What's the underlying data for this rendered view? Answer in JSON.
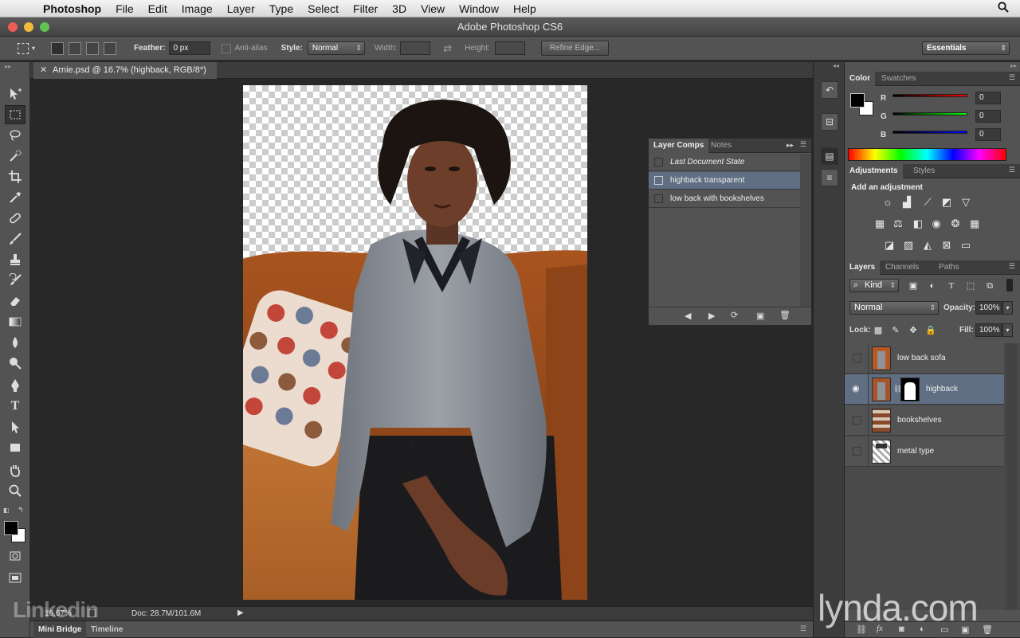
{
  "menubar": {
    "app": "Photoshop",
    "items": [
      "File",
      "Edit",
      "Image",
      "Layer",
      "Type",
      "Select",
      "Filter",
      "3D",
      "View",
      "Window",
      "Help"
    ]
  },
  "window": {
    "title": "Adobe Photoshop CS6"
  },
  "options": {
    "feather_label": "Feather:",
    "feather_value": "0 px",
    "antialias_label": "Anti-alias",
    "style_label": "Style:",
    "style_value": "Normal",
    "width_label": "Width:",
    "height_label": "Height:",
    "refine_button": "Refine Edge...",
    "workspace": "Essentials"
  },
  "document": {
    "tab_title": "Arnie.psd @ 16.7% (highback, RGB/8*)"
  },
  "status": {
    "zoom": "16.67%",
    "doc": "Doc: 28.7M/101.6M"
  },
  "bottom_tabs": [
    "Mini Bridge",
    "Timeline"
  ],
  "layer_comps": {
    "tabs": [
      "Layer Comps",
      "Notes"
    ],
    "items": [
      {
        "label": "Last Document State",
        "italic": true,
        "selected": false
      },
      {
        "label": "highback transparent",
        "italic": false,
        "selected": true
      },
      {
        "label": "low back with bookshelves",
        "italic": false,
        "selected": false
      }
    ]
  },
  "color_panel": {
    "tabs": [
      "Color",
      "Swatches"
    ],
    "channels": [
      {
        "label": "R",
        "value": "0",
        "gradient": "#ff0000"
      },
      {
        "label": "G",
        "value": "0",
        "gradient": "#00ff00"
      },
      {
        "label": "B",
        "value": "0",
        "gradient": "#0000ff"
      }
    ]
  },
  "adjustments": {
    "tabs": [
      "Adjustments",
      "Styles"
    ],
    "header": "Add an adjustment",
    "row1": [
      "brightness-icon",
      "levels-icon",
      "curves-icon",
      "exposure-icon",
      "vibrance-icon"
    ],
    "row2": [
      "hue-sat-icon",
      "color-balance-icon",
      "bw-icon",
      "photo-filter-icon",
      "channel-mixer-icon",
      "color-lookup-icon"
    ],
    "row3": [
      "invert-icon",
      "posterize-icon",
      "threshold-icon",
      "selective-color-icon",
      "gradient-map-icon"
    ]
  },
  "layers": {
    "tabs": [
      "Layers",
      "Channels",
      "Paths"
    ],
    "filter_label": "Kind",
    "blend_mode": "Normal",
    "opacity_label": "Opacity:",
    "opacity_value": "100%",
    "lock_label": "Lock:",
    "fill_label": "Fill:",
    "fill_value": "100%",
    "items": [
      {
        "name": "low back sofa",
        "visible": false,
        "selected": false,
        "mask": false
      },
      {
        "name": "highback",
        "visible": true,
        "selected": true,
        "mask": true
      },
      {
        "name": "bookshelves",
        "visible": false,
        "selected": false,
        "mask": false
      },
      {
        "name": "metal type",
        "visible": false,
        "selected": false,
        "mask": false
      }
    ]
  },
  "watermarks": {
    "left": "Linkedin",
    "right": "lynda.com"
  },
  "colors": {
    "selection": "#5f6e82",
    "panel": "#535353",
    "dark": "#282828"
  }
}
